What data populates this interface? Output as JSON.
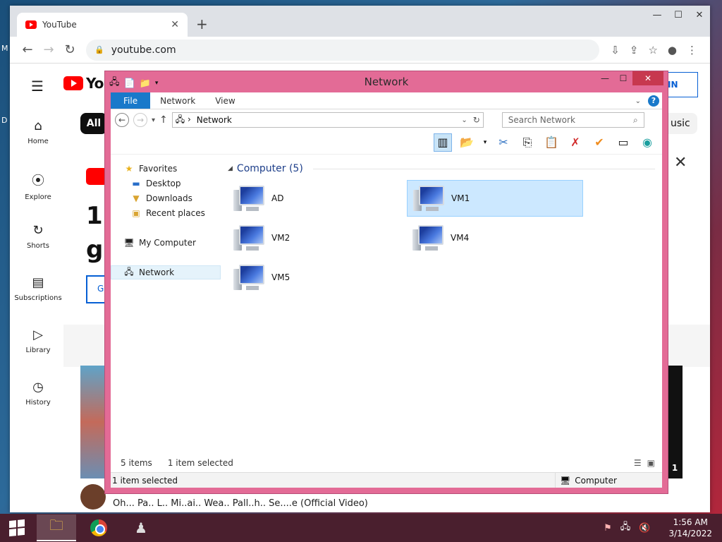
{
  "desktop": {
    "glyphs": [
      "M",
      "D"
    ]
  },
  "chrome": {
    "tab_title": "YouTube",
    "url": "youtube.com",
    "window_controls": [
      "—",
      "☐",
      "✕"
    ]
  },
  "youtube": {
    "logo_text": "You",
    "sidebar": [
      {
        "label": "Home",
        "icon": "home-icon",
        "glyph": "⌂"
      },
      {
        "label": "Explore",
        "icon": "compass-icon",
        "glyph": "⦿"
      },
      {
        "label": "Shorts",
        "icon": "shorts-icon",
        "glyph": "↻"
      },
      {
        "label": "Subscriptions",
        "icon": "subscriptions-icon",
        "glyph": "▤"
      },
      {
        "label": "Library",
        "icon": "library-icon",
        "glyph": "▷"
      },
      {
        "label": "History",
        "icon": "history-icon",
        "glyph": "◷"
      }
    ],
    "chip_all": "All",
    "chip_music": "usic",
    "signin_partial": "IN",
    "big_text_1": "1",
    "big_text_2": "gr",
    "g_button": "G",
    "thumb_right_text": "1",
    "video_titles": "Oh... Pa.. L.. Mi..ai..       Wea.. Pall..h..       Se....e  (Official Video)"
  },
  "explorer": {
    "title": "Network",
    "ribbon_tabs": [
      "File",
      "Network",
      "View"
    ],
    "address_path": "Network",
    "search_placeholder": "Search Network",
    "nav": {
      "favorites_label": "Favorites",
      "favorites": [
        "Desktop",
        "Downloads",
        "Recent places"
      ],
      "my_computer": "My Computer",
      "network": "Network"
    },
    "group_header": "Computer (5)",
    "items": [
      {
        "name": "AD",
        "selected": false
      },
      {
        "name": "VM1",
        "selected": true
      },
      {
        "name": "VM2",
        "selected": false
      },
      {
        "name": "VM4",
        "selected": false
      },
      {
        "name": "VM5",
        "selected": false
      }
    ],
    "status_count": "5 items",
    "status_selected": "1 item selected",
    "details_selected": "1 item selected",
    "details_type": "Computer"
  },
  "taskbar": {
    "time": "1:56 AM",
    "date": "3/14/2022"
  },
  "colors": {
    "explorer_frame": "#e36b96",
    "ribbon_file": "#1979ca",
    "selection": "#cce8ff",
    "taskbar": "#4a1f2e"
  }
}
